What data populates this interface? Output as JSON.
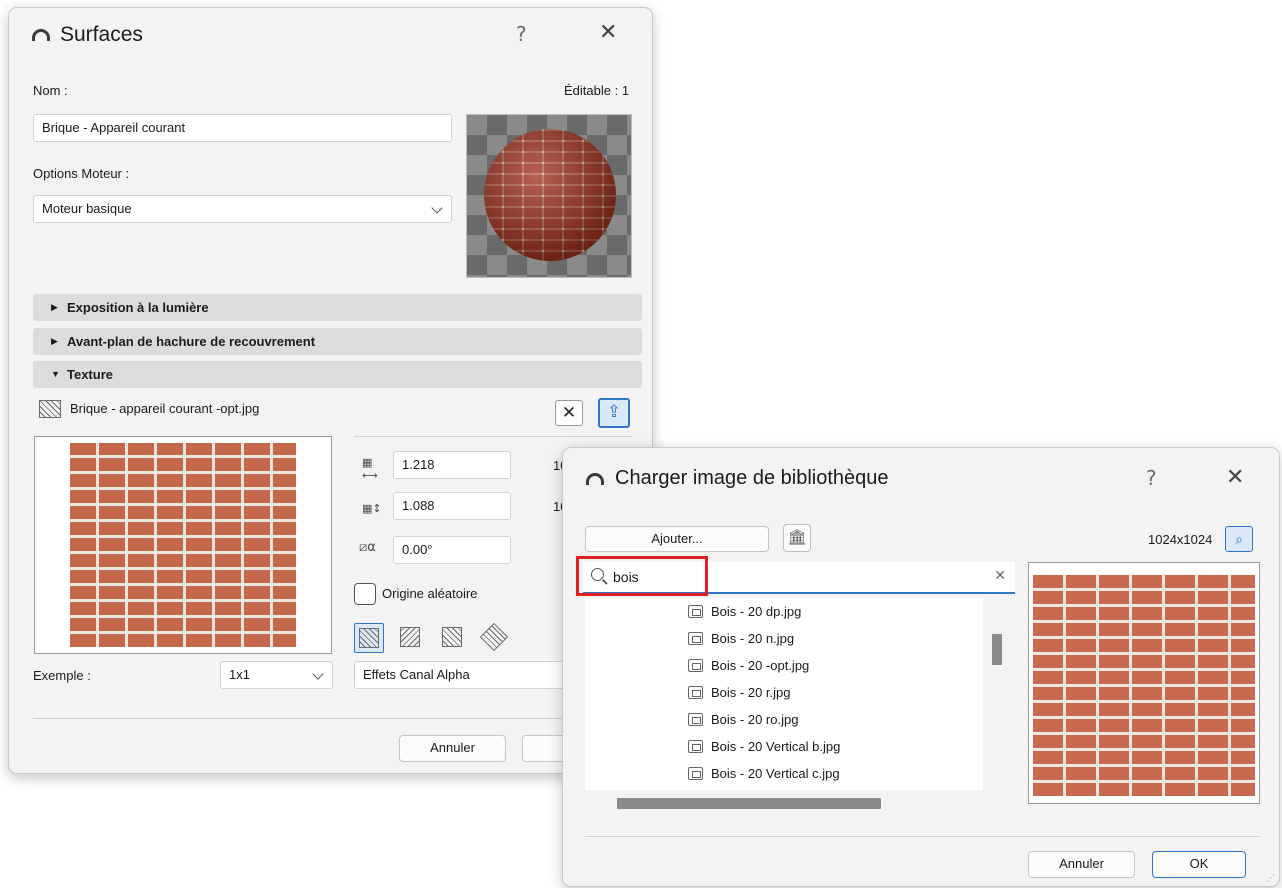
{
  "surfaces": {
    "title": "Surfaces",
    "help": "?",
    "close": "✕",
    "name_label": "Nom :",
    "editable_label": "Éditable : 1",
    "name_value": "Brique - Appareil courant",
    "engine_label": "Options Moteur :",
    "engine_value": "Moteur basique",
    "sections": {
      "exposition": "Exposition à la lumière",
      "avant_plan": "Avant-plan de hachure de recouvrement",
      "texture": "Texture"
    },
    "texture_file": "Brique - appareil courant -opt.jpg",
    "width_value": "1.218",
    "height_value": "1.088",
    "angle_value": "0.00°",
    "width_suffix": "10",
    "height_suffix": "10",
    "random_origin_label": "Origine aléatoire",
    "example_label": "Exemple :",
    "example_value": "1x1",
    "alpha_value": "Effets Canal Alpha",
    "cancel_button": "Annuler"
  },
  "library_dialog": {
    "title": "Charger image de bibliothèque",
    "help": "?",
    "close": "✕",
    "add_button": "Ajouter...",
    "resolution": "1024x1024",
    "search_value": "bois",
    "search_clear": "✕",
    "files": [
      "Bois - 20 dp.jpg",
      "Bois - 20 n.jpg",
      "Bois - 20 -opt.jpg",
      "Bois - 20 r.jpg",
      "Bois - 20 ro.jpg",
      "Bois - 20 Vertical b.jpg",
      "Bois - 20 Vertical c.jpg"
    ],
    "cancel_button": "Annuler",
    "ok_button": "OK"
  },
  "colors": {
    "dialog_bg": "#f3f3f3",
    "section_bg": "#dcdcdc",
    "highlight_red": "#e02020",
    "accent_blue": "#2f76c9",
    "brick": "#c4674b"
  }
}
